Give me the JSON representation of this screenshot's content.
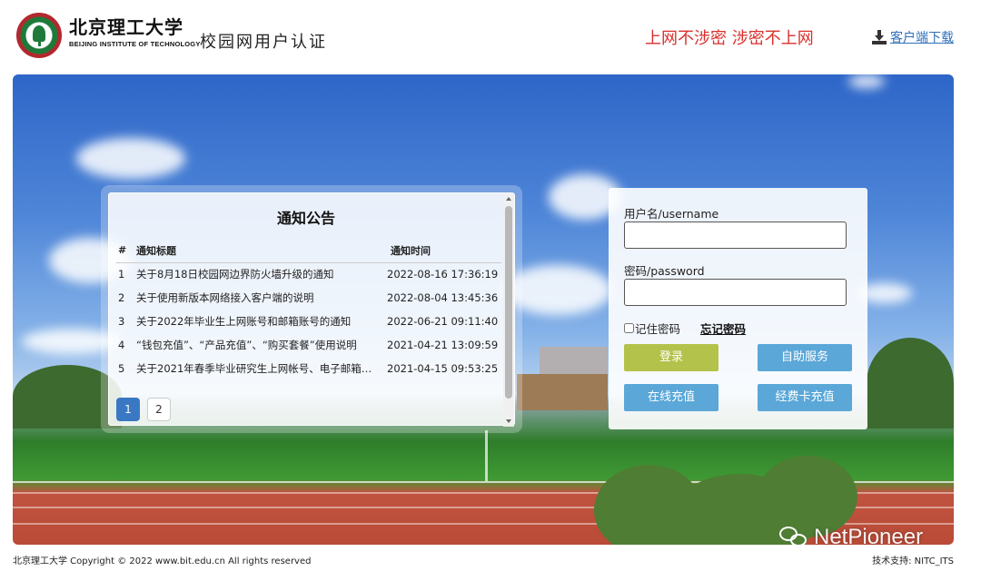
{
  "header": {
    "university_name": "北京理工大学",
    "university_en": "BEIJING INSTITUTE OF TECHNOLOGY",
    "system_name": "校园网用户认证",
    "slogan": "上网不涉密 涉密不上网",
    "download_label": "客户端下载"
  },
  "notice": {
    "title": "通知公告",
    "columns": [
      "#",
      "通知标题",
      "通知时间"
    ],
    "rows": [
      {
        "idx": "1",
        "title": "关于8月18日校园网边界防火墙升级的通知",
        "time": "2022-08-16 17:36:19"
      },
      {
        "idx": "2",
        "title": "关于使用新版本网络接入客户端的说明",
        "time": "2022-08-04 13:45:36"
      },
      {
        "idx": "3",
        "title": "关于2022年毕业生上网账号和邮箱账号的通知",
        "time": "2022-06-21 09:11:40"
      },
      {
        "idx": "4",
        "title": "“钱包充值”、“产品充值”、“购买套餐”使用说明",
        "time": "2021-04-21 13:09:59"
      },
      {
        "idx": "5",
        "title": "关于2021年春季毕业研究生上网帐号、电子邮箱…",
        "time": "2021-04-15 09:53:25"
      }
    ],
    "pages": [
      "1",
      "2"
    ],
    "current_page": "1"
  },
  "login": {
    "username_label": "用户名/username",
    "username_value": "",
    "password_label": "密码/password",
    "password_value": "",
    "remember_label": "记住密码",
    "forgot_label": "忘记密码",
    "login_button": "登录",
    "self_service_button": "自助服务",
    "online_recharge_button": "在线充值",
    "card_recharge_button": "经费卡充值"
  },
  "colors": {
    "slogan": "#d9302c",
    "link": "#2f6fba",
    "login_button": "#b3c24a",
    "service_button": "#5aa7d8",
    "page_active": "#3a78c3"
  },
  "footer": {
    "copyright": "北京理工大学 Copyright © 2022 www.bit.edu.cn All rights reserved",
    "support": "技术支持: NITC_ITS"
  },
  "watermark": {
    "text": "NetPioneer",
    "icon": "wechat-icon"
  }
}
